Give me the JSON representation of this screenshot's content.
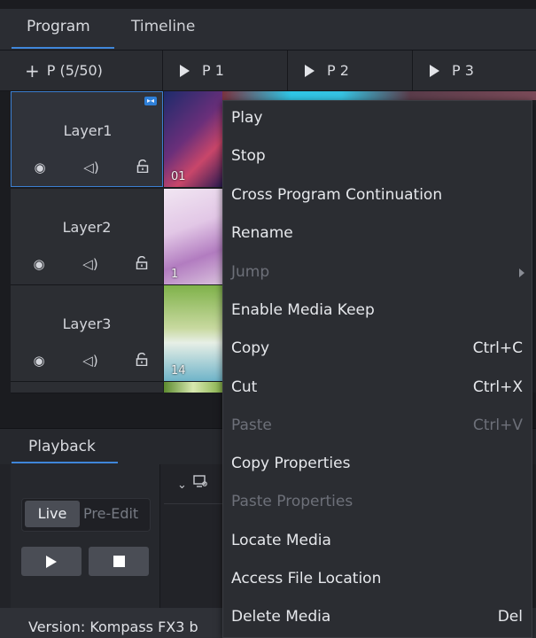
{
  "tabs": {
    "program": "Program",
    "timeline": "Timeline"
  },
  "program_header": {
    "add_label": "P (5/50)",
    "programs": [
      "P 1",
      "P 2",
      "P 3"
    ]
  },
  "layers": [
    {
      "name": "Layer1",
      "thumb_label": "01"
    },
    {
      "name": "Layer2",
      "thumb_label": "1"
    },
    {
      "name": "Layer3",
      "thumb_label": "14"
    }
  ],
  "layer_icons": {
    "visibility": "◉",
    "audio": "◁)",
    "lock": "🔓"
  },
  "playback": {
    "tab_label": "Playback",
    "live_label": "Live",
    "preedit_label": "Pre-Edit"
  },
  "status": {
    "version_text": "Version: Kompass FX3 b"
  },
  "context_menu": {
    "items": [
      {
        "label": "Play",
        "shortcut": "",
        "disabled": false
      },
      {
        "label": "Stop",
        "shortcut": "",
        "disabled": false
      },
      {
        "label": "Cross Program Continuation",
        "shortcut": "",
        "disabled": false
      },
      {
        "label": "Rename",
        "shortcut": "",
        "disabled": false
      },
      {
        "label": "Jump",
        "shortcut": "",
        "disabled": true,
        "submenu": true
      },
      {
        "label": "Enable Media Keep",
        "shortcut": "",
        "disabled": false
      },
      {
        "label": "Copy",
        "shortcut": "Ctrl+C",
        "disabled": false
      },
      {
        "label": "Cut",
        "shortcut": "Ctrl+X",
        "disabled": false
      },
      {
        "label": "Paste",
        "shortcut": "Ctrl+V",
        "disabled": true
      },
      {
        "label": "Copy Properties",
        "shortcut": "",
        "disabled": false
      },
      {
        "label": "Paste Properties",
        "shortcut": "",
        "disabled": true
      },
      {
        "label": "Locate Media",
        "shortcut": "",
        "disabled": false
      },
      {
        "label": "Access File Location",
        "shortcut": "",
        "disabled": false
      },
      {
        "label": "Delete Media",
        "shortcut": "Del",
        "disabled": false
      }
    ]
  },
  "colors": {
    "accent": "#3f86d9",
    "background": "#1b1c20",
    "menu_bg": "#2b2d32"
  }
}
